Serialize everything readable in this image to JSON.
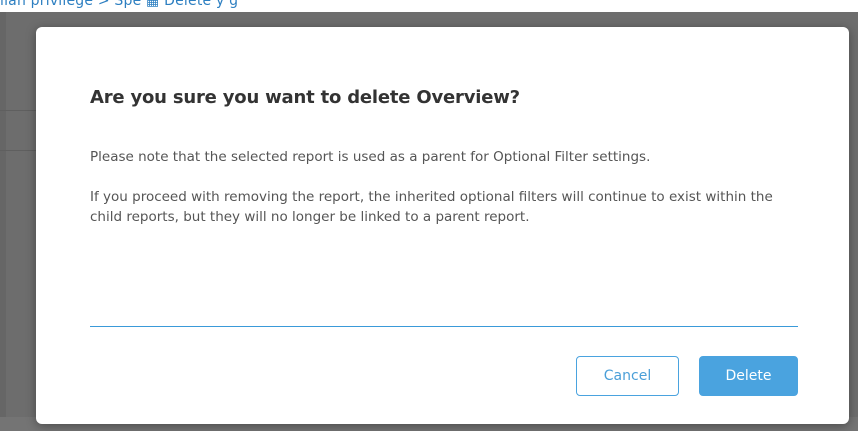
{
  "background": {
    "breadcrumb_text": "lian privilege  >  Spe  ▦ Delete                                                    y                       g"
  },
  "dialog": {
    "title": "Are you sure you want to delete Overview?",
    "paragraphs": [
      "Please note that the selected report is used as a parent for Optional Filter settings.",
      "If you proceed with removing the report, the inherited optional filters will continue to exist within the child reports, but they will no longer be linked to a parent report."
    ],
    "buttons": {
      "cancel_label": "Cancel",
      "delete_label": "Delete"
    }
  },
  "colors": {
    "accent": "#4aa3df",
    "overlay": "#6d6d6d",
    "title": "#333333",
    "body_text": "#555555"
  }
}
